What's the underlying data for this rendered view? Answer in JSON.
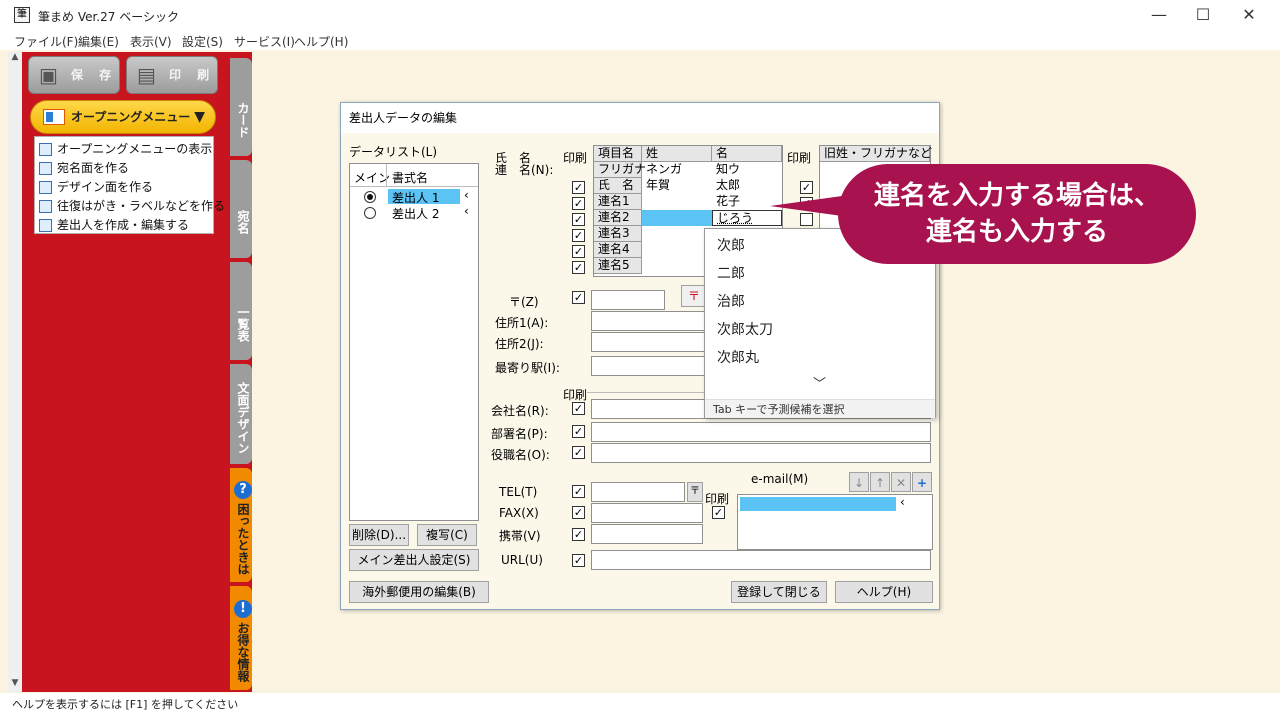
{
  "window": {
    "title": "筆まめ Ver.27 ベーシック",
    "minimize": "—",
    "maximize": "☐",
    "close": "✕"
  },
  "menubar": [
    "ファイル(F)",
    "編集(E)",
    "表示(V)",
    "設定(S)",
    "サービス(I)",
    "ヘルプ(H)"
  ],
  "left_panel": {
    "save_label": "保 存",
    "print_label": "印 刷",
    "opening_menu_label": "オープニングメニュー",
    "opening_menu_caret": "▼",
    "menu_items": [
      "オープニングメニューの表示",
      "宛名面を作る",
      "デザイン面を作る",
      "往復はがき・ラベルなどを作る",
      "差出人を作成・編集する"
    ],
    "tabs": [
      "カード",
      "宛名",
      "一覧表",
      "文面デザイン",
      "困ったときは",
      "お得な情報"
    ],
    "tab_help_icon": "?",
    "tab_info_icon": "!"
  },
  "dialog": {
    "title": "差出人データの編集",
    "data_list_label": "データリスト(L)",
    "list_headers": [
      "メイン",
      "書式名"
    ],
    "list_rows": [
      {
        "name": "差出人 1",
        "selected": true
      },
      {
        "name": "差出人 2",
        "selected": false
      }
    ],
    "delete_button": "削除(D)...",
    "copy_button": "複写(C)",
    "main_sender_button": "メイン差出人設定(S)",
    "overseas_button": "海外郵便用の編集(B)",
    "register_close_button": "登録して閉じる",
    "help_button": "ヘルプ(H)",
    "name_label_1": "氏　名",
    "name_label_2": "連　名(N):",
    "print_label": "印刷",
    "name_grid": {
      "headers": [
        "項目名",
        "姓",
        "名"
      ],
      "rows": [
        {
          "item": "フリガナ",
          "sei": "ネンガ",
          "mei": "知ウ"
        },
        {
          "item": "氏　名",
          "sei": "年賀",
          "mei": "太郎"
        },
        {
          "item": "連名1",
          "sei": "",
          "mei": "花子"
        },
        {
          "item": "連名2",
          "sei": "",
          "mei": "じろう"
        },
        {
          "item": "連名3",
          "sei": "",
          "mei": ""
        },
        {
          "item": "連名4",
          "sei": "",
          "mei": ""
        },
        {
          "item": "連名5",
          "sei": "",
          "mei": ""
        }
      ]
    },
    "old_name_header": "旧姓・フリガナなど",
    "postal_label": "〒(Z)",
    "address1_label": "住所1(A):",
    "address2_label": "住所2(J):",
    "station_label": "最寄り駅(I):",
    "company_label": "会社名(R):",
    "department_label": "部署名(P):",
    "title_label": "役職名(O):",
    "tel_label": "TEL(T)",
    "fax_label": "FAX(X)",
    "mobile_label": "携帯(V)",
    "url_label": "URL(U)",
    "email_label": "e-mail(M)",
    "email_tools": [
      "↓",
      "↑",
      "✕",
      "+"
    ]
  },
  "autocomplete": {
    "options": [
      "次郎",
      "二郎",
      "治郎",
      "次郎太刀",
      "次郎丸"
    ],
    "more": "﹀",
    "footer": "Tab キーで予測候補を選択"
  },
  "callout": {
    "line1": "連名を入力する場合は、",
    "line2": "連名も入力する"
  },
  "status": "ヘルプを表示するには [F1] を押してください",
  "colors": {
    "red_panel": "#c8141e",
    "callout": "#a8124e",
    "selection": "#5cc3f5"
  }
}
